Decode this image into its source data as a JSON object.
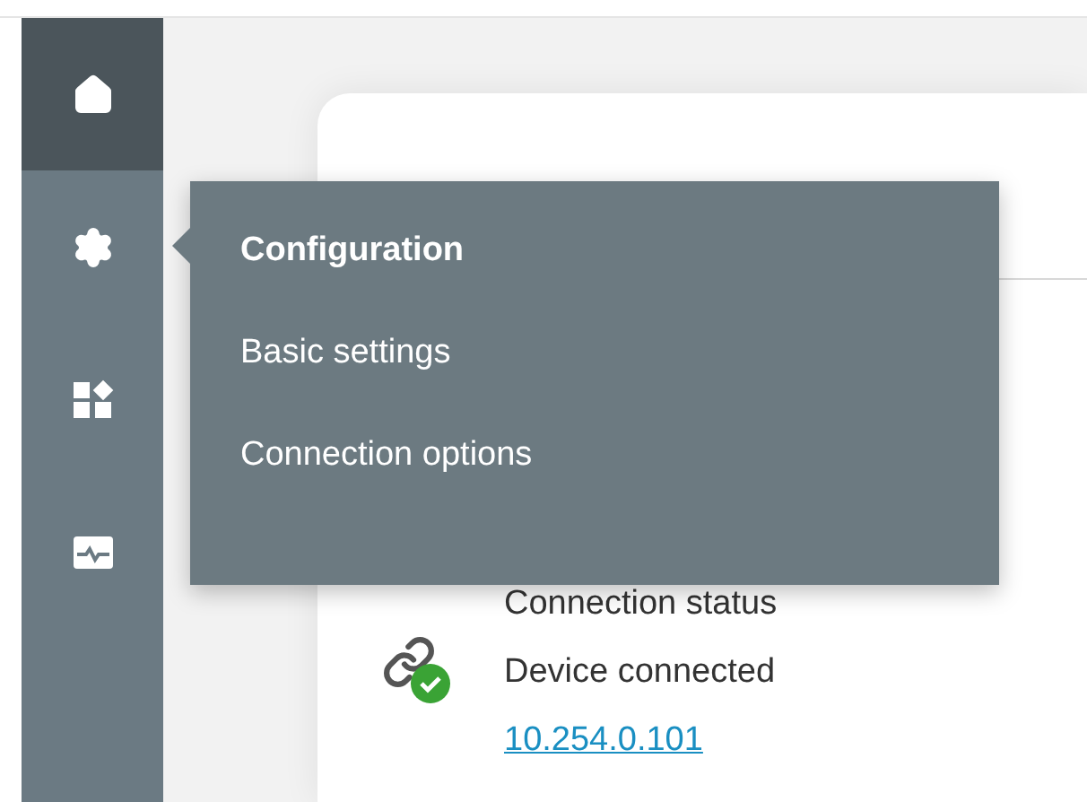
{
  "sidebar": {
    "items": [
      {
        "kind": "home",
        "selected": true
      },
      {
        "kind": "settings",
        "selected": false
      },
      {
        "kind": "apps",
        "selected": false
      },
      {
        "kind": "monitor",
        "selected": false
      }
    ]
  },
  "card": {
    "connection": {
      "label": "Connection status",
      "status": "Device connected",
      "address": "10.254.0.101",
      "connected": true
    }
  },
  "flyout": {
    "title": "Configuration",
    "items": [
      "Basic settings",
      "Connection options"
    ]
  }
}
